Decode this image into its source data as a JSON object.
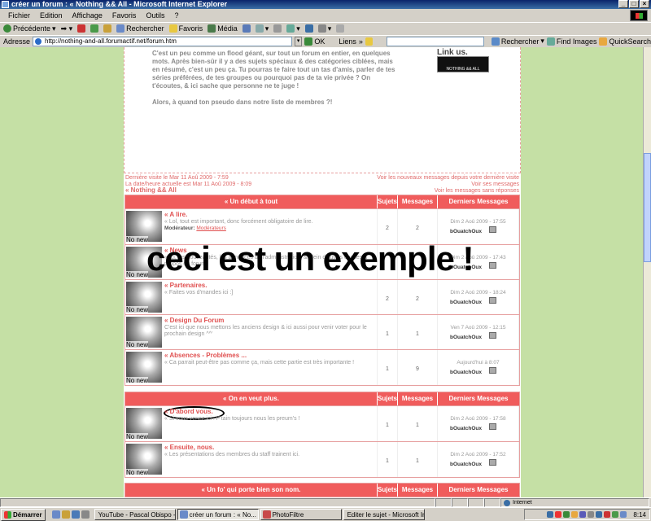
{
  "window": {
    "title": "créer un forum : « Nothing && All - Microsoft Internet Explorer"
  },
  "menu": [
    "Fichier",
    "Edition",
    "Affichage",
    "Favoris",
    "Outils",
    "?"
  ],
  "toolbar": {
    "back": "Précédente",
    "search": "Rechercher",
    "favorites": "Favoris",
    "media": "Média"
  },
  "address": {
    "label": "Adresse",
    "url": "http://nothing-and-all.forumactif.net/forum.htm",
    "go": "OK",
    "links": "Liens"
  },
  "search_toolbar": {
    "search": "Rechercher",
    "find_images": "Find Images",
    "quicksearch": "QuickSearch"
  },
  "intro": {
    "text": "C'est un peu comme un flood géant, sur tout un forum en entier, en quelques mots. Après bien-sûr il y a des sujets spéciaux & des catégories ciblées, mais en résumé, c'est un peu ça. Tu pourras te faire tout un tas d'amis, parler de tes séries préférées, de tes groupes ou pourquoi pas de ta vie privée ? On t'écoutes, & ici sache que personne ne te juge !",
    "question": "Alors, à quand ton pseudo dans notre liste de membres ?!",
    "link_us": "Link us.",
    "logo_text": "NOTHING && ALL"
  },
  "info": {
    "last_visit": "Dernière visite le Mar 11 Aoû 2009 - 7:59",
    "now": "La date/heure actuelle est Mar 11 Aoû 2009 - 8:09",
    "forum_link": "« Nothing && All",
    "new_since": "Voir les nouveaux messages depuis votre dernière visite",
    "my_msgs": "Voir ses messages",
    "unanswered": "Voir les messages sans réponses"
  },
  "headers": {
    "topics": "Sujets",
    "messages": "Messages",
    "last": "Derniers Messages"
  },
  "categories": [
    {
      "name": "« Un début à tout",
      "forums": [
        {
          "title": "« A lire.",
          "desc": "« Lol, tout est important, donc forcément obligatoire de lire.",
          "mod_label": "Modérateur:",
          "mod": "Modérateurs",
          "topics": "2",
          "posts": "2",
          "date": "Dim 2 Aoû 2009 - 17:55",
          "user": "bOuatchOux",
          "icon": "No new"
        },
        {
          "title": "« News",
          "desc": "« Ici, les nouveautés, les annonces de l'administration, & plein d'autres choses à propos du forum.",
          "mod_label": "",
          "mod": "",
          "topics": "",
          "posts": "",
          "date": "Dim 2 Aoû 2009 - 17:43",
          "user": "bOuatchOux",
          "icon": "No new"
        },
        {
          "title": "« Partenaires.",
          "desc": "« Faites vos d'mandes ici :]",
          "mod_label": "",
          "mod": "",
          "topics": "2",
          "posts": "2",
          "date": "Dim 2 Aoû 2009 - 18:24",
          "user": "bOuatchOux",
          "icon": "No new"
        },
        {
          "title": "« Design Du Forum",
          "desc": "C'est ici que nous mettons les anciens design & ici aussi pour venir voter pour le prochain design ^^'",
          "mod_label": "",
          "mod": "",
          "topics": "1",
          "posts": "1",
          "date": "Ven 7 Aoû 2009 - 12:15",
          "user": "bOuatchOux",
          "icon": "No new"
        },
        {
          "title": "« Absences - Problèmes ...",
          "desc": "« Ca parrait peut-être pas comme ça, mais cette partie est très importante !",
          "mod_label": "",
          "mod": "",
          "topics": "1",
          "posts": "9",
          "date": "Aujourd'hui à 8:07",
          "user": "bOuatchOux",
          "icon": "No new"
        }
      ]
    },
    {
      "name": "« On en veut plus.",
      "forums": [
        {
          "title": "« D'abord vous.",
          "desc": "« Si vous venez ici : P'tain toujours nous les preum's !",
          "mod_label": "",
          "mod": "",
          "topics": "1",
          "posts": "1",
          "date": "Dim 2 Aoû 2009 - 17:58",
          "user": "bOuatchOux",
          "icon": "No new"
        },
        {
          "title": "« Ensuite, nous.",
          "desc": "« Les présentations des membres du staff trainent ici.",
          "mod_label": "",
          "mod": "",
          "topics": "1",
          "posts": "1",
          "date": "Dim 2 Aoû 2009 - 17:52",
          "user": "bOuatchOux",
          "icon": "No new"
        }
      ]
    },
    {
      "name": "« Un fo' qui porte bien son nom.",
      "forums": []
    }
  ],
  "overlay": "ceci est un exemple !",
  "status": {
    "zone": "Internet"
  },
  "taskbar": {
    "start": "Démarrer",
    "items": [
      "YouTube - Pascal Obispo -...",
      "créer un forum : « No...",
      "PhotoFiltre",
      "Editer le sujet - Microsoft In..."
    ],
    "clock": "8:14"
  }
}
